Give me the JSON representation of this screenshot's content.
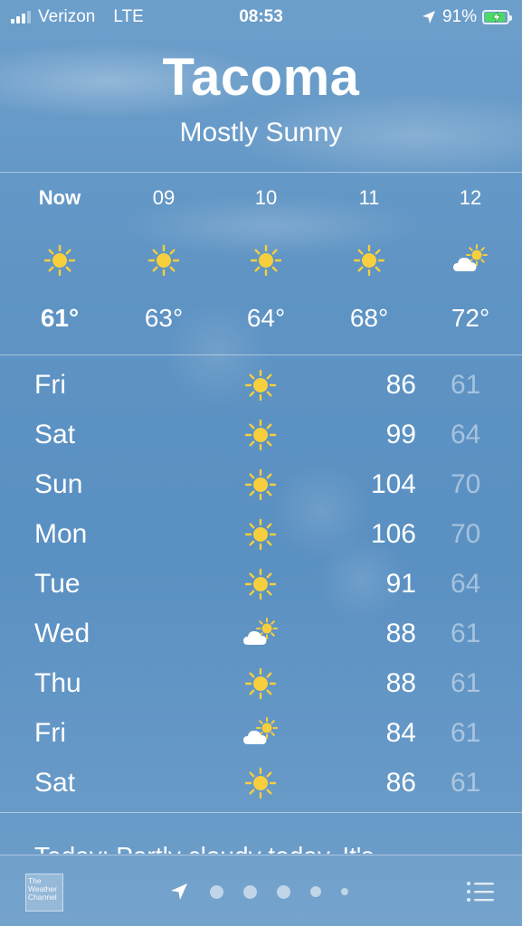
{
  "status_bar": {
    "carrier": "Verizon",
    "network": "LTE",
    "time": "08:53",
    "battery": "91%",
    "battery_level": 0.91
  },
  "header": {
    "city": "Tacoma",
    "condition": "Mostly Sunny"
  },
  "hourly": [
    {
      "label": "Now",
      "icon": "sun-icon",
      "temp": "61°"
    },
    {
      "label": "09",
      "icon": "sun-icon",
      "temp": "63°"
    },
    {
      "label": "10",
      "icon": "sun-icon",
      "temp": "64°"
    },
    {
      "label": "11",
      "icon": "sun-icon",
      "temp": "68°"
    },
    {
      "label": "12",
      "icon": "partly-cloudy-icon",
      "temp": "72°"
    }
  ],
  "daily": [
    {
      "day": "Fri",
      "icon": "sun-icon",
      "high": "86",
      "low": "61"
    },
    {
      "day": "Sat",
      "icon": "sun-icon",
      "high": "99",
      "low": "64"
    },
    {
      "day": "Sun",
      "icon": "sun-icon",
      "high": "104",
      "low": "70"
    },
    {
      "day": "Mon",
      "icon": "sun-icon",
      "high": "106",
      "low": "70"
    },
    {
      "day": "Tue",
      "icon": "sun-icon",
      "high": "91",
      "low": "64"
    },
    {
      "day": "Wed",
      "icon": "partly-cloudy-icon",
      "high": "88",
      "low": "61"
    },
    {
      "day": "Thu",
      "icon": "sun-icon",
      "high": "88",
      "low": "61"
    },
    {
      "day": "Fri",
      "icon": "partly-cloudy-icon",
      "high": "84",
      "low": "61"
    },
    {
      "day": "Sat",
      "icon": "sun-icon",
      "high": "86",
      "low": "61"
    }
  ],
  "summary": "Today: Partly cloudy today. It's",
  "bottom_bar": {
    "logo_text": "The Weather Channel",
    "page_count": 5,
    "current_page": 0
  },
  "colors": {
    "sun": "#f7cf3c",
    "sky": "#5f94c4",
    "low_temp": "rgba(255,255,255,0.45)"
  }
}
